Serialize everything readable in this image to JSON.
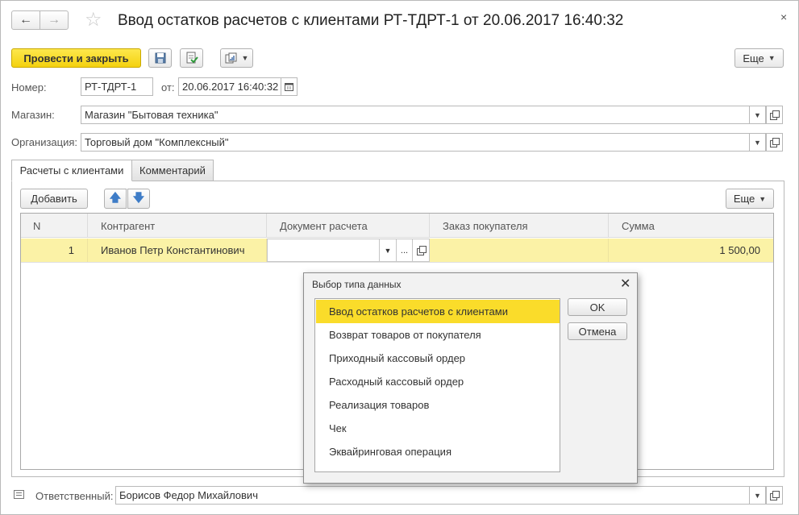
{
  "window": {
    "title": "Ввод остатков расчетов с клиентами РТ-ТДРТ-1 от 20.06.2017 16:40:32",
    "back_icon": "←",
    "forward_icon": "→",
    "star_icon": "☆",
    "close_icon": "×"
  },
  "toolbar": {
    "post_and_close": "Провести и закрыть",
    "more": "Еще"
  },
  "form": {
    "number_label": "Номер:",
    "number_value": "РТ-ТДРТ-1",
    "date_label": "от:",
    "date_value": "20.06.2017 16:40:32",
    "store_label": "Магазин:",
    "store_value": "Магазин \"Бытовая техника\"",
    "org_label": "Организация:",
    "org_value": "Торговый дом \"Комплексный\"",
    "responsible_label": "Ответственный:",
    "responsible_value": "Борисов Федор Михайлович"
  },
  "tabs": [
    {
      "label": "Расчеты с клиентами",
      "active": true
    },
    {
      "label": "Комментарий",
      "active": false
    }
  ],
  "table_toolbar": {
    "add": "Добавить",
    "more": "Еще"
  },
  "table": {
    "columns": [
      "N",
      "Контрагент",
      "Документ расчета",
      "Заказ покупателя",
      "Сумма"
    ],
    "rows": [
      {
        "n": "1",
        "counterparty": "Иванов Петр Константинович",
        "document": "",
        "order": "",
        "amount": "1 500,00",
        "ellipsis": "..."
      }
    ]
  },
  "dialog": {
    "title": "Выбор типа данных",
    "close_icon": "✕",
    "items": [
      "Ввод остатков расчетов с клиентами",
      "Возврат товаров от покупателя",
      "Приходный кассовый ордер",
      "Расходный кассовый ордер",
      "Реализация товаров",
      "Чек",
      "Эквайринговая операция"
    ],
    "selected_index": 0,
    "ok": "OK",
    "cancel": "Отмена"
  },
  "colors": {
    "accent_yellow": "#f4d10f",
    "selection_yellow": "#fadc2a",
    "row_highlight": "#fbf2a6"
  }
}
